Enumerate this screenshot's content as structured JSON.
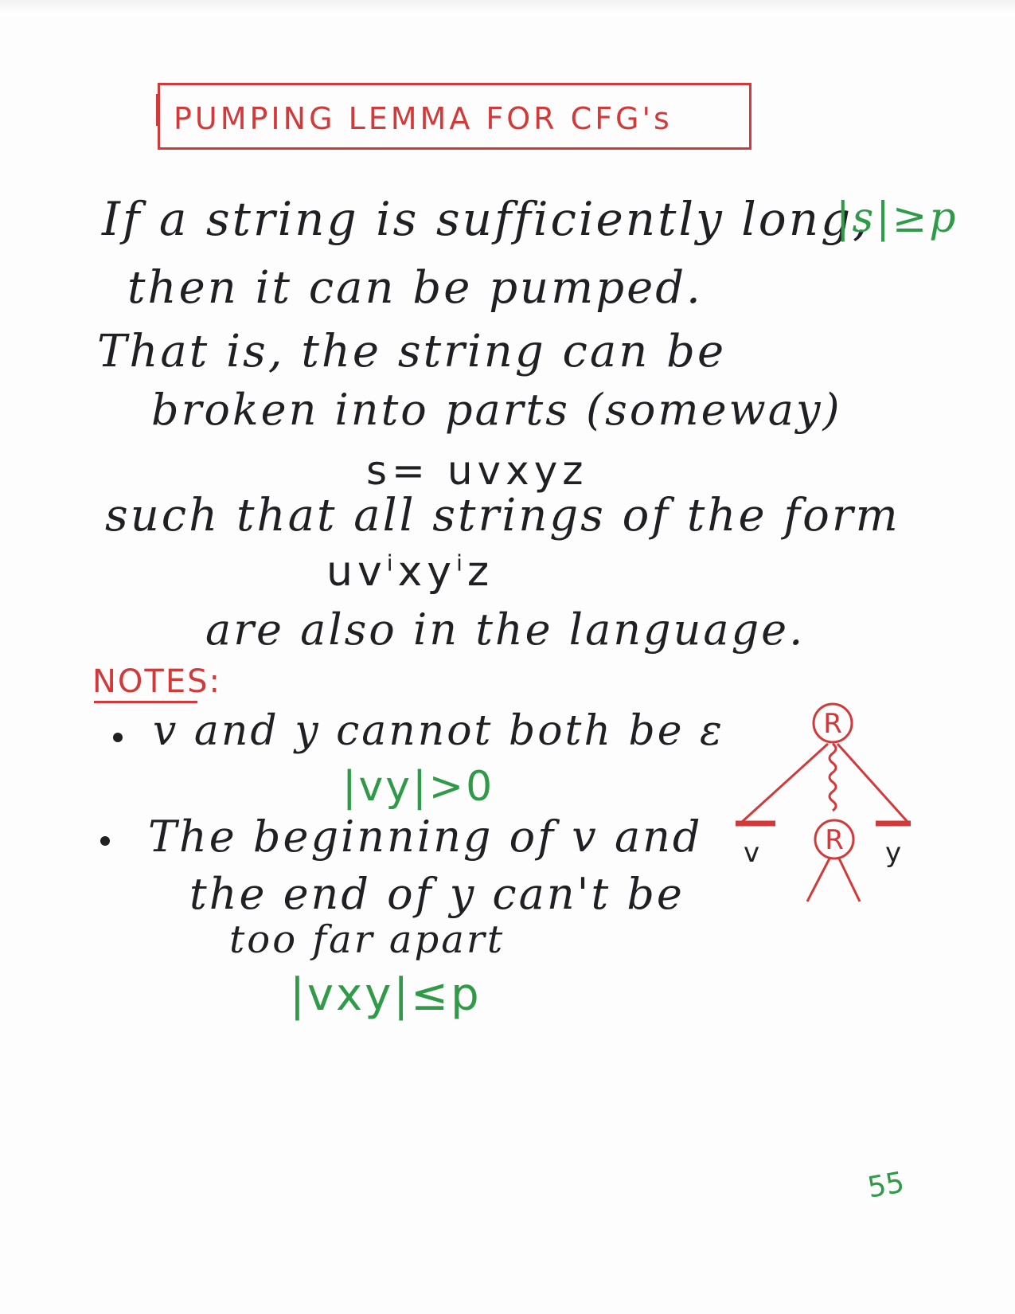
{
  "title": "PUMPING LEMMA FOR CFG's",
  "body": {
    "line1": "If a string is sufficiently long,",
    "line1_green": "|s|≥p",
    "line2": "then it can be pumped.",
    "line3": "That is, the string can be",
    "line4": "broken into parts (someway)",
    "line5": "s= uvxyz",
    "line6": "such that all strings of the form",
    "line7_base": "uv",
    "line7_sup1": "i",
    "line7_mid": "xy",
    "line7_sup2": "i",
    "line7_end": "z",
    "line8": "are also in the language."
  },
  "notes": {
    "heading": "NOTES:",
    "note1": "v and y cannot both be ε",
    "note1_green": "|vy|>0",
    "note2_line1": "The beginning of v and",
    "note2_line2": "the end of y can't be",
    "note2_line3": "too far apart",
    "note2_green": "|vxy|≤p"
  },
  "diagram": {
    "top_node": "R",
    "inner_node": "R",
    "left_label": "v",
    "right_label": "y"
  },
  "page_number": "55",
  "colors": {
    "black_ink": "#1f1f24",
    "red_ink": "#d23a3a",
    "green_ink": "#2f9a47"
  }
}
